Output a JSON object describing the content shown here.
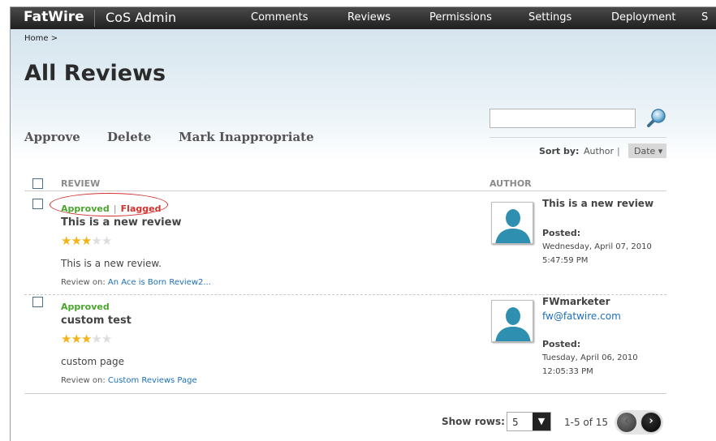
{
  "topbar": {
    "brand": "FatWire",
    "app_name": "CoS Admin",
    "nav": [
      "Comments",
      "Reviews",
      "Permissions",
      "Settings",
      "Deployment",
      "S"
    ]
  },
  "breadcrumb": "Home  >",
  "page_title": "All Reviews",
  "actions": {
    "approve": "Approve",
    "delete": "Delete",
    "mark_inappropriate": "Mark Inappropriate"
  },
  "search": {
    "value": "",
    "placeholder": ""
  },
  "sort": {
    "label": "Sort by:",
    "author": "Author",
    "pipe": "|",
    "date": "Date ▾"
  },
  "columns": {
    "review": "REVIEW",
    "author": "AUTHOR"
  },
  "reviews": [
    {
      "status_approved": "Approved",
      "status_pipe": "|",
      "status_flagged": "Flagged",
      "title": "This is a new review",
      "rating": 3,
      "max_rating": 5,
      "body": "This is a new review.",
      "review_on_label": "Review on:",
      "review_on_link": "An Ace is Born Review2...",
      "author_name": "This is a new review",
      "author_email": "",
      "posted_label": "Posted:",
      "posted_date": "Wednesday, April 07, 2010",
      "posted_time": "5:47:59 PM"
    },
    {
      "status_approved": "Approved",
      "status_pipe": "",
      "status_flagged": "",
      "title": "custom test",
      "rating": 3,
      "max_rating": 5,
      "body": "custom page",
      "review_on_label": "Review on:",
      "review_on_link": "Custom Reviews Page",
      "author_name": "FWmarketer",
      "author_email": "fw@fatwire.com",
      "posted_label": "Posted:",
      "posted_date": "Tuesday, April 06, 2010",
      "posted_time": "12:05:33 PM"
    }
  ],
  "pagination": {
    "show_rows_label": "Show rows:",
    "rows_value": "5",
    "range": "1-5 of 15",
    "prev": "‹",
    "next": "›"
  },
  "colors": {
    "approved": "#4aa52e",
    "flagged": "#d2322d",
    "link": "#1d6fb8",
    "star": "#f2b418"
  }
}
